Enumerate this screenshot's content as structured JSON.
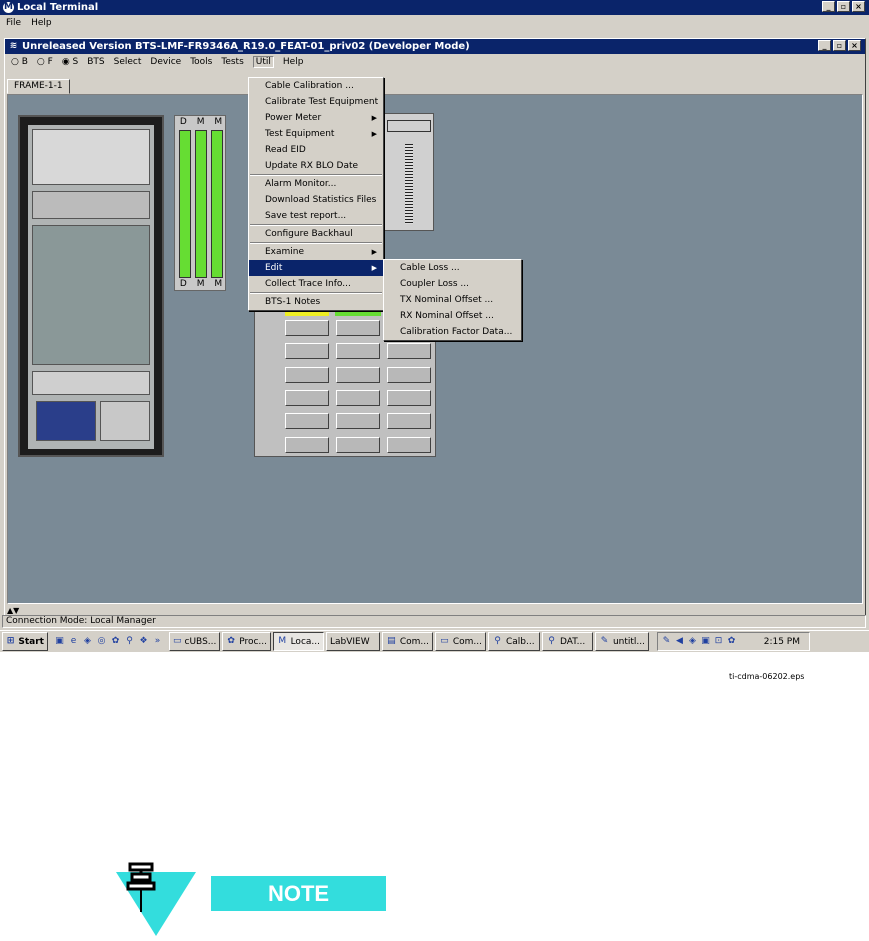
{
  "outer_window": {
    "title": "Local Terminal",
    "menu": [
      "File",
      "Help"
    ],
    "buttons": [
      "_",
      "▫",
      "×"
    ]
  },
  "inner_window": {
    "title": "Unreleased Version BTS-LMF-FR9346A_R19.0_FEAT-01_priv02 (Developer Mode)",
    "radio_options": [
      "B",
      "F",
      "S"
    ],
    "menu": [
      "BTS",
      "Select",
      "Device",
      "Tools",
      "Tests",
      "Util",
      "Help"
    ],
    "tab": "FRAME-1-1"
  },
  "rack_labels": {
    "top": [
      "D",
      "M",
      "M"
    ],
    "bottom": [
      "D",
      "M",
      "M"
    ]
  },
  "util_menu": {
    "items": [
      {
        "label": "Cable Calibration ...",
        "submenu": false
      },
      {
        "label": "Calibrate Test Equipment",
        "submenu": false
      },
      {
        "label": "Power Meter",
        "submenu": true
      },
      {
        "label": "Test Equipment",
        "submenu": true
      },
      {
        "label": "Read EID",
        "submenu": false
      },
      {
        "label": "Update RX BLO Date",
        "submenu": false
      },
      {
        "label": "Alarm Monitor...",
        "submenu": false
      },
      {
        "label": "Download Statistics Files",
        "submenu": false
      },
      {
        "label": "Save test report...",
        "submenu": false
      },
      {
        "label": "Configure Backhaul",
        "submenu": false
      },
      {
        "label": "Examine",
        "submenu": true
      },
      {
        "label": "Edit",
        "submenu": true
      },
      {
        "label": "Collect Trace Info...",
        "submenu": false
      },
      {
        "label": "BTS-1 Notes",
        "submenu": false
      }
    ]
  },
  "edit_submenu": [
    "Cable Loss ...",
    "Coupler Loss ...",
    "TX Nominal Offset ...",
    "RX Nominal Offset ...",
    "Calibration Factor Data..."
  ],
  "status": {
    "connection": "Connection Mode: Local Manager"
  },
  "taskbar": {
    "start": "Start",
    "tasks": [
      "cUBS...",
      "Proc...",
      "Loca...",
      "LabVIEW",
      "Com...",
      "Com...",
      "Calb...",
      "DAT...",
      "untitl..."
    ],
    "clock": "2:15 PM"
  },
  "caption": "ti-cdma-06202.eps",
  "note": "NOTE",
  "colors": {
    "titlebar": "#0a246a",
    "workspace": "#7a8a96",
    "note_bg": "#33dddd",
    "card_green": "#66dd33"
  }
}
